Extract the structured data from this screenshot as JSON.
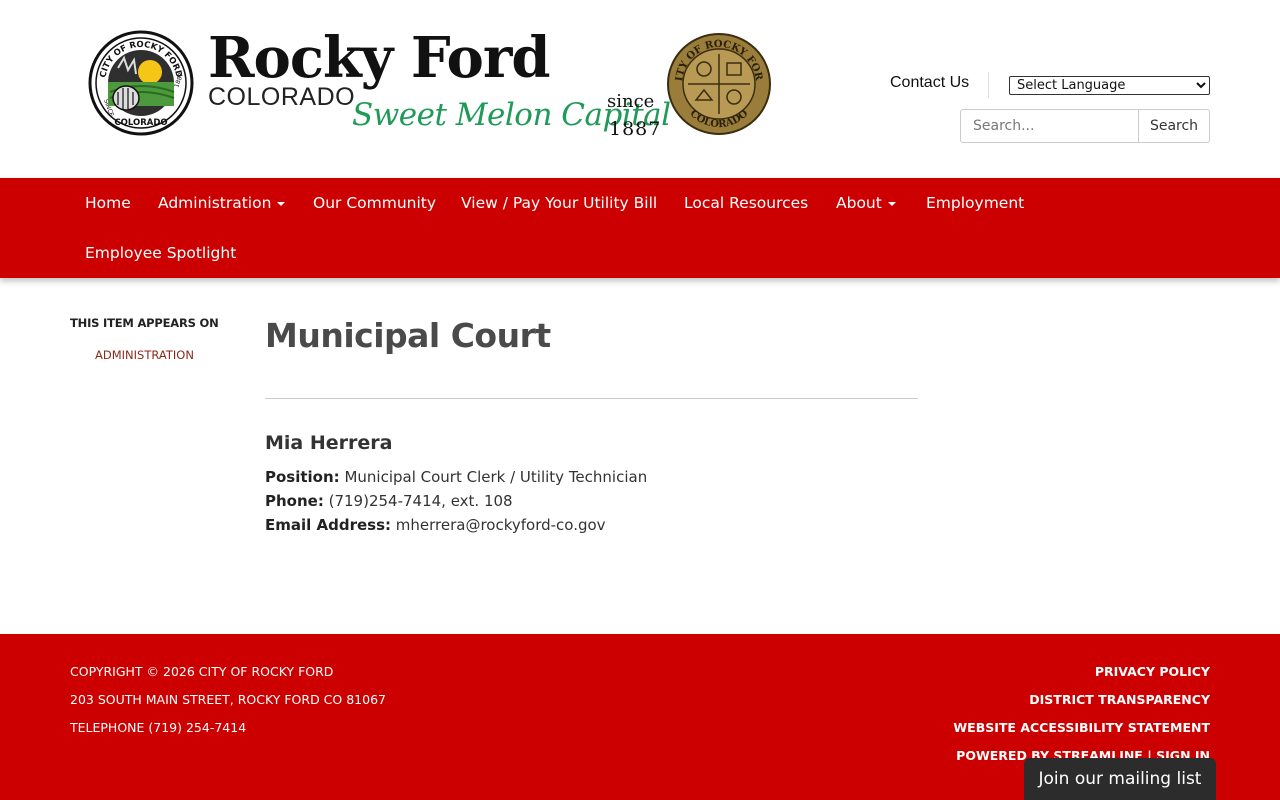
{
  "header": {
    "logo": {
      "title": "Rocky Ford",
      "state": "COLORADO",
      "tagline": "Sweet Melon Capital",
      "since": "since",
      "year": "1887",
      "seal_left_text_top": "CITY OF ROCKY FORD",
      "seal_left_text_bottom": "COLORADO",
      "seal_left_since": "SINCE",
      "seal_left_year": "1887",
      "seal_right_text_top": "CITY OF ROCKY FORD",
      "seal_right_text_bottom": "COLORADO"
    },
    "contact_label": "Contact Us",
    "language_select": "Select Language",
    "search_placeholder": "Search...",
    "search_button": "Search"
  },
  "nav": {
    "items": [
      {
        "label": "Home",
        "dropdown": false
      },
      {
        "label": "Administration",
        "dropdown": true
      },
      {
        "label": "Our Community",
        "dropdown": false
      },
      {
        "label": "View / Pay Your Utility Bill",
        "dropdown": false
      },
      {
        "label": "Local Resources",
        "dropdown": false
      },
      {
        "label": "About",
        "dropdown": true
      },
      {
        "label": "Employment",
        "dropdown": false
      },
      {
        "label": "Employee Spotlight",
        "dropdown": false
      }
    ]
  },
  "sidebar": {
    "heading": "THIS ITEM APPEARS ON",
    "link": "ADMINISTRATION"
  },
  "main": {
    "title": "Municipal Court",
    "person": {
      "name": "Mia Herrera",
      "position_label": "Position:",
      "position": "Municipal Court Clerk / Utility Technician",
      "phone_label": "Phone:",
      "phone": "(719)254-7414, ext. 108",
      "email_label": "Email Address:",
      "email": "mherrera@rockyford-co.gov"
    }
  },
  "footer": {
    "copyright": "COPYRIGHT © 2026 CITY OF ROCKY FORD",
    "address": "203 SOUTH MAIN STREET, ROCKY FORD CO 81067",
    "telephone": "TELEPHONE (719) 254-7414",
    "privacy": "PRIVACY POLICY",
    "transparency": "DISTRICT TRANSPARENCY",
    "accessibility": "WEBSITE ACCESSIBILITY STATEMENT",
    "powered": "POWERED BY STREAMLINE",
    "separator": "|",
    "sign_in": "SIGN IN"
  },
  "mailing_list": "Join our mailing list",
  "colors": {
    "brand_red": "#cc0000",
    "tagline_green": "#1f9a58",
    "seal_gold": "#9a7d3a"
  }
}
